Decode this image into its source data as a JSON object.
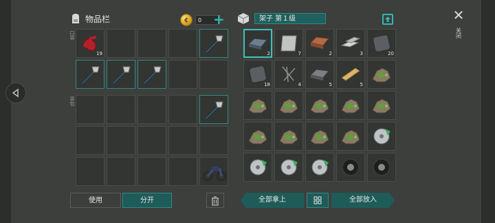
{
  "inventory": {
    "title": "物品栏",
    "coins": "0",
    "pocket_label": "口袋",
    "backpack_label": "背包",
    "pocket_slots": [
      {
        "item": "red-cloth",
        "count": "19"
      },
      {
        "item": "",
        "count": ""
      },
      {
        "item": "",
        "count": ""
      },
      {
        "item": "",
        "count": ""
      },
      {
        "item": "axe",
        "count": ""
      },
      {
        "item": "axe",
        "count": ""
      },
      {
        "item": "axe",
        "count": ""
      },
      {
        "item": "axe",
        "count": ""
      },
      {
        "item": "",
        "count": ""
      },
      {
        "item": "",
        "count": ""
      }
    ],
    "backpack_slots": [
      {
        "item": "",
        "count": ""
      },
      {
        "item": "",
        "count": ""
      },
      {
        "item": "",
        "count": ""
      },
      {
        "item": "",
        "count": ""
      },
      {
        "item": "axe",
        "count": ""
      },
      {
        "item": "",
        "count": ""
      },
      {
        "item": "",
        "count": ""
      },
      {
        "item": "",
        "count": ""
      },
      {
        "item": "",
        "count": ""
      },
      {
        "item": "",
        "count": ""
      },
      {
        "item": "",
        "count": ""
      },
      {
        "item": "",
        "count": ""
      },
      {
        "item": "",
        "count": ""
      },
      {
        "item": "",
        "count": ""
      },
      {
        "item": "motorcycle",
        "count": ""
      }
    ]
  },
  "shelf": {
    "title": "架子 第１级",
    "slots": [
      {
        "item": "iron-ingot",
        "count": "2"
      },
      {
        "item": "metal-sheet",
        "count": "7"
      },
      {
        "item": "copper-ingot",
        "count": "2"
      },
      {
        "item": "steel-bars",
        "count": "3"
      },
      {
        "item": "iron-plate",
        "count": "20"
      },
      {
        "item": "iron-plate",
        "count": "18"
      },
      {
        "item": "nails",
        "count": "4"
      },
      {
        "item": "steel-ingot",
        "count": "5"
      },
      {
        "item": "wood-plank",
        "count": "5"
      },
      {
        "item": "ore",
        "count": ""
      },
      {
        "item": "ore",
        "count": ""
      },
      {
        "item": "ore",
        "count": ""
      },
      {
        "item": "ore",
        "count": ""
      },
      {
        "item": "ore",
        "count": ""
      },
      {
        "item": "ore",
        "count": ""
      },
      {
        "item": "ore",
        "count": ""
      },
      {
        "item": "ore",
        "count": ""
      },
      {
        "item": "ore",
        "count": ""
      },
      {
        "item": "ore",
        "count": ""
      },
      {
        "item": "saw-blade",
        "count": ""
      },
      {
        "item": "saw-blade",
        "count": ""
      },
      {
        "item": "saw-blade",
        "count": ""
      },
      {
        "item": "saw-blade",
        "count": ""
      },
      {
        "item": "tire",
        "count": ""
      },
      {
        "item": "tire",
        "count": ""
      }
    ]
  },
  "buttons": {
    "use": "使用",
    "split": "分开",
    "take_all": "全部拿上",
    "put_all": "全部放入",
    "close": "关闭"
  },
  "colors": {
    "accent": "#2fb8b0",
    "selected": "#3bc3bb",
    "button": "#1e5c59"
  }
}
